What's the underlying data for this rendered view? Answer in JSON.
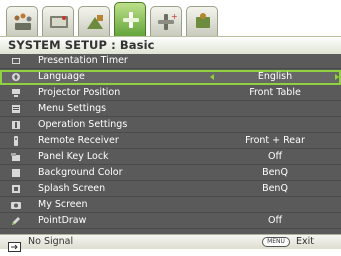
{
  "tabs": [
    {
      "name": "picture",
      "icon": "picture-icon"
    },
    {
      "name": "display",
      "icon": "display-icon"
    },
    {
      "name": "advanced-picture",
      "icon": "advanced-picture-icon"
    },
    {
      "name": "system-setup-basic",
      "icon": "system-setup-basic-icon",
      "active": true
    },
    {
      "name": "system-setup-advanced",
      "icon": "system-setup-advanced-icon"
    },
    {
      "name": "information",
      "icon": "information-icon"
    }
  ],
  "title": "SYSTEM SETUP : Basic",
  "menu": {
    "items": [
      {
        "label": "Presentation Timer",
        "value": "",
        "icon": "timer-icon"
      },
      {
        "label": "Language",
        "value": "English",
        "icon": "language-icon",
        "selected": true
      },
      {
        "label": "Projector Position",
        "value": "Front Table",
        "icon": "projector-icon"
      },
      {
        "label": "Menu Settings",
        "value": "",
        "icon": "menu-icon"
      },
      {
        "label": "Operation Settings",
        "value": "",
        "icon": "operation-icon"
      },
      {
        "label": "Remote Receiver",
        "value": "Front + Rear",
        "icon": "remote-icon"
      },
      {
        "label": "Panel Key Lock",
        "value": "Off",
        "icon": "lock-icon"
      },
      {
        "label": "Background Color",
        "value": "BenQ",
        "icon": "background-icon"
      },
      {
        "label": "Splash Screen",
        "value": "BenQ",
        "icon": "splash-icon"
      },
      {
        "label": "My Screen",
        "value": "",
        "icon": "camera-icon"
      },
      {
        "label": "PointDraw",
        "value": "Off",
        "icon": "pen-icon"
      }
    ]
  },
  "status": {
    "signal": "No Signal",
    "menu_key": "MENU",
    "exit": "Exit"
  },
  "colors": {
    "accent": "#8fd13f",
    "menu_bg": "#5a5a5a",
    "title_text": "#333333"
  }
}
